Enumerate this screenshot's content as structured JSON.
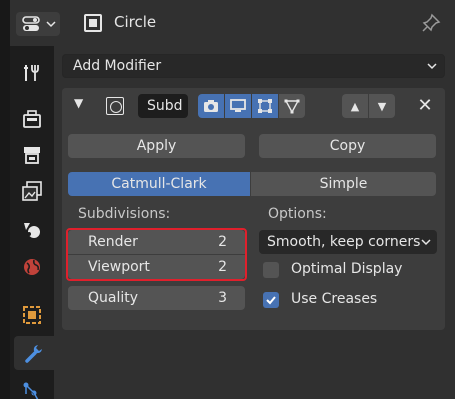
{
  "header": {
    "object_name": "Circle",
    "icons": [
      "editor-type-icon",
      "object-icon",
      "pin-icon"
    ]
  },
  "tabs": [
    "tool-icon",
    "render-icon",
    "output-icon",
    "view-layer-icon",
    "scene-icon",
    "world-icon",
    "object-icon",
    "modifier-icon",
    "particles-icon"
  ],
  "panel": {
    "add_modifier_label": "Add Modifier",
    "modifier": {
      "name": "Subd",
      "apply_label": "Apply",
      "copy_label": "Copy",
      "algorithms": [
        "Catmull-Clark",
        "Simple"
      ],
      "selected_algorithm": "Catmull-Clark",
      "subdivisions_label": "Subdivisions:",
      "render_label": "Render",
      "render_value": "2",
      "viewport_label": "Viewport",
      "viewport_value": "2",
      "quality_label": "Quality",
      "quality_value": "3",
      "options_label": "Options:",
      "uv_smooth_value": "Smooth, keep corners",
      "optimal_display_label": "Optimal Display",
      "optimal_display_checked": false,
      "use_creases_label": "Use Creases",
      "use_creases_checked": true
    }
  },
  "colors": {
    "accent": "#4772b3",
    "highlight_outline": "#e0202c",
    "panel_bg": "#303030",
    "box_bg": "#3d3d3d",
    "button_bg": "#545454"
  }
}
